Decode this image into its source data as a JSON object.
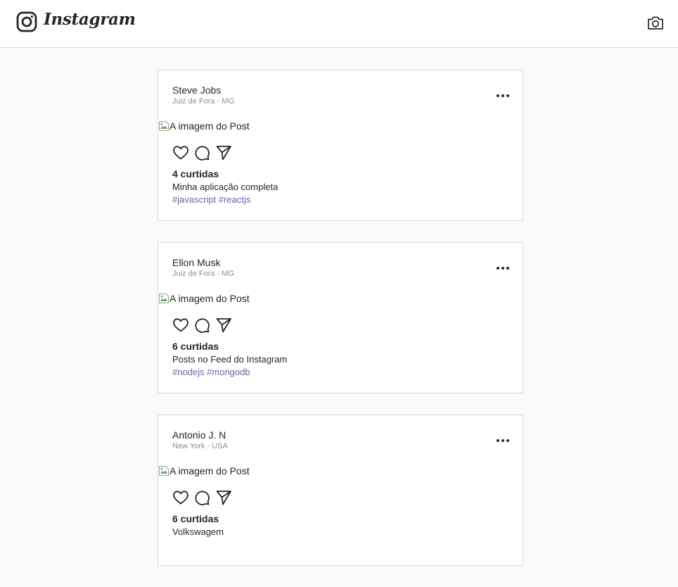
{
  "header": {
    "logo_text": "Instagram",
    "logo_icon": "instagram-icon",
    "camera_icon": "camera-icon"
  },
  "colors": {
    "background": "#fafafa",
    "card": "#ffffff",
    "border": "#dbdbdb",
    "hashtag": "#7161a8",
    "muted": "#8e8e8e"
  },
  "posts": [
    {
      "author": "Steve Jobs",
      "place": "Juiz de Fora - MG",
      "image_alt": "A imagem do Post",
      "likes": "4 curtidas",
      "description": "Minha aplicação completa",
      "hashtags": "#javascript #reactjs"
    },
    {
      "author": "Ellon Musk",
      "place": "Juiz de Fora - MG",
      "image_alt": "A imagem do Post",
      "likes": "6 curtidas",
      "description": "Posts no Feed do Instagram",
      "hashtags": "#nodejs #mongodb"
    },
    {
      "author": "Antonio J. N",
      "place": "New York - USA",
      "image_alt": "A imagem do Post",
      "likes": "6 curtidas",
      "description": "Volkswagem",
      "hashtags": ""
    }
  ]
}
